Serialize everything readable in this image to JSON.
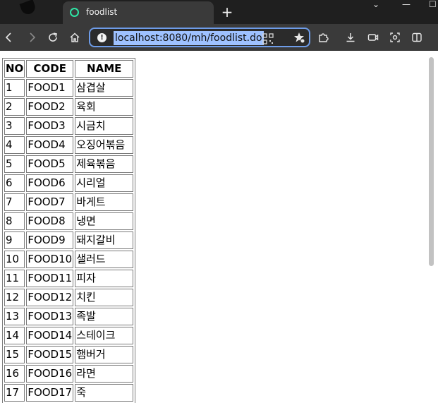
{
  "browser": {
    "tab_title": "foodlist",
    "new_tab_label": "+",
    "window_controls": [
      "⌄",
      "—",
      "☐"
    ],
    "address": "localhost:8080/mh/foodlist.do",
    "icons": {
      "back": "arrow-left-icon",
      "forward": "arrow-right-icon",
      "refresh": "refresh-icon",
      "home": "home-icon",
      "site_info": "info-icon",
      "qr": "qr-code-icon",
      "favorites": "star-add-icon",
      "extensions": "puzzle-icon",
      "downloads": "download-icon",
      "media": "media-icon",
      "screenshot": "camera-icon",
      "split": "split-screen-icon"
    },
    "colors": {
      "tabstrip": "#1f1f1f",
      "active_tab": "#3a3a3a",
      "favicon": "#2ee5a5",
      "address_border": "#6e9ce8",
      "address_selection": "#9ec1ff"
    }
  },
  "page": {
    "headers": [
      "NO",
      "CODE",
      "NAME"
    ],
    "rows": [
      {
        "no": "1",
        "code": "FOOD1",
        "name": "삼겹살"
      },
      {
        "no": "2",
        "code": "FOOD2",
        "name": "육회"
      },
      {
        "no": "3",
        "code": "FOOD3",
        "name": "시금치"
      },
      {
        "no": "4",
        "code": "FOOD4",
        "name": "오징어볶음"
      },
      {
        "no": "5",
        "code": "FOOD5",
        "name": "제육볶음"
      },
      {
        "no": "6",
        "code": "FOOD6",
        "name": "시리얼"
      },
      {
        "no": "7",
        "code": "FOOD7",
        "name": "바게트"
      },
      {
        "no": "8",
        "code": "FOOD8",
        "name": "냉면"
      },
      {
        "no": "9",
        "code": "FOOD9",
        "name": "돼지갈비"
      },
      {
        "no": "10",
        "code": "FOOD10",
        "name": "샐러드"
      },
      {
        "no": "11",
        "code": "FOOD11",
        "name": "피자"
      },
      {
        "no": "12",
        "code": "FOOD12",
        "name": "치킨"
      },
      {
        "no": "13",
        "code": "FOOD13",
        "name": "족발"
      },
      {
        "no": "14",
        "code": "FOOD14",
        "name": "스테이크"
      },
      {
        "no": "15",
        "code": "FOOD15",
        "name": "햄버거"
      },
      {
        "no": "16",
        "code": "FOOD16",
        "name": "라면"
      },
      {
        "no": "17",
        "code": "FOOD17",
        "name": "죽"
      }
    ]
  }
}
